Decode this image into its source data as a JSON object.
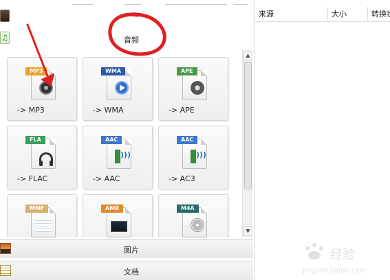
{
  "section": {
    "title": "音频"
  },
  "tiles": [
    {
      "badge": "MP3",
      "label": "-> MP3",
      "badge_color": "#f0a030"
    },
    {
      "badge": "WMA",
      "label": "-> WMA",
      "badge_color": "#2c5aa8"
    },
    {
      "badge": "APE",
      "label": "-> APE",
      "badge_color": "#4a9a4a"
    },
    {
      "badge": "FLA",
      "label": "-> FLAC",
      "badge_color": "#3aa05a"
    },
    {
      "badge": "AAC",
      "label": "-> AAC",
      "badge_color": "#3a7ac8"
    },
    {
      "badge": "AAC",
      "label": "-> AC3",
      "badge_color": "#3a7ac8"
    },
    {
      "badge": "MMF",
      "label": "",
      "badge_color": "#d8b070"
    },
    {
      "badge": "AMR",
      "label": "",
      "badge_color": "#e08a30"
    },
    {
      "badge": "M4A",
      "label": "",
      "badge_color": "#2a6a6a"
    }
  ],
  "categories": {
    "pictures": "图片",
    "documents": "文档"
  },
  "table": {
    "columns": [
      "来源",
      "大小",
      "转换状"
    ]
  },
  "annotation_color": "#e02020",
  "watermark": "Baidu 经验 jingyan.baidu.com"
}
